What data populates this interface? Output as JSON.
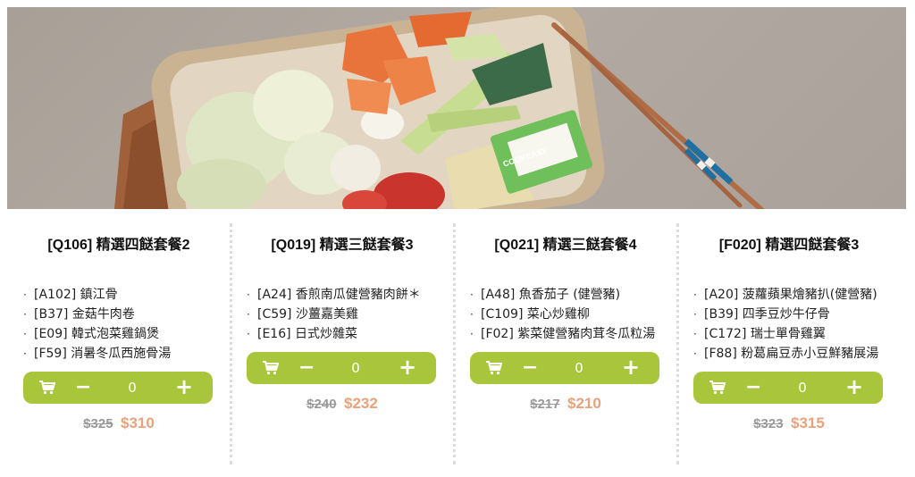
{
  "banner": {
    "brand_text": "COOKEASY"
  },
  "colors": {
    "accent": "#a9c53c",
    "sale": "#e8a27a",
    "original": "#999999"
  },
  "cart": {
    "icon": "cart-icon",
    "minus": "−",
    "plus": "+"
  },
  "products": [
    {
      "title": "[Q106] 精選四餸套餐2",
      "items": [
        {
          "bullet": "·",
          "text": "[A102] 鎮江骨"
        },
        {
          "bullet": "·",
          "text": "[B37] 金菇牛肉卷"
        },
        {
          "bullet": "·",
          "text": "[E09] 韓式泡菜雞鍋煲"
        },
        {
          "bullet": "·",
          "text": "[F59] 消暑冬瓜西施骨湯"
        }
      ],
      "qty": "0",
      "original_price": "$325",
      "sale_price": "$310"
    },
    {
      "title": "[Q019] 精選三餸套餐3",
      "items": [
        {
          "bullet": "·",
          "text": "[A24] 香煎南瓜健營豬肉餅＊"
        },
        {
          "bullet": "·",
          "text": "[C59] 沙薑嘉美雞"
        },
        {
          "bullet": "·",
          "text": "[E16] 日式炒雜菜"
        }
      ],
      "qty": "0",
      "original_price": "$240",
      "sale_price": "$232"
    },
    {
      "title": "[Q021] 精選三餸套餐4",
      "items": [
        {
          "bullet": "·",
          "text": "[A48] 魚香茄子 (健營豬)"
        },
        {
          "bullet": "·",
          "text": "[C109] 菜心炒雞柳"
        },
        {
          "bullet": "·",
          "text": "[F02] 紫菜健營豬肉茸冬瓜粒湯"
        }
      ],
      "qty": "0",
      "original_price": "$217",
      "sale_price": "$210"
    },
    {
      "title": "[F020] 精選四餸套餐3",
      "items": [
        {
          "bullet": "·",
          "text": "[A20] 菠蘿蘋果燴豬扒(健營豬)"
        },
        {
          "bullet": "·",
          "text": "[B39] 四季豆炒牛仔骨"
        },
        {
          "bullet": "·",
          "text": "[C172] 瑞士單骨雞翼"
        },
        {
          "bullet": "·",
          "text": "[F88] 粉葛扁豆赤小豆鮮豬展湯"
        }
      ],
      "qty": "0",
      "original_price": "$323",
      "sale_price": "$315"
    }
  ]
}
